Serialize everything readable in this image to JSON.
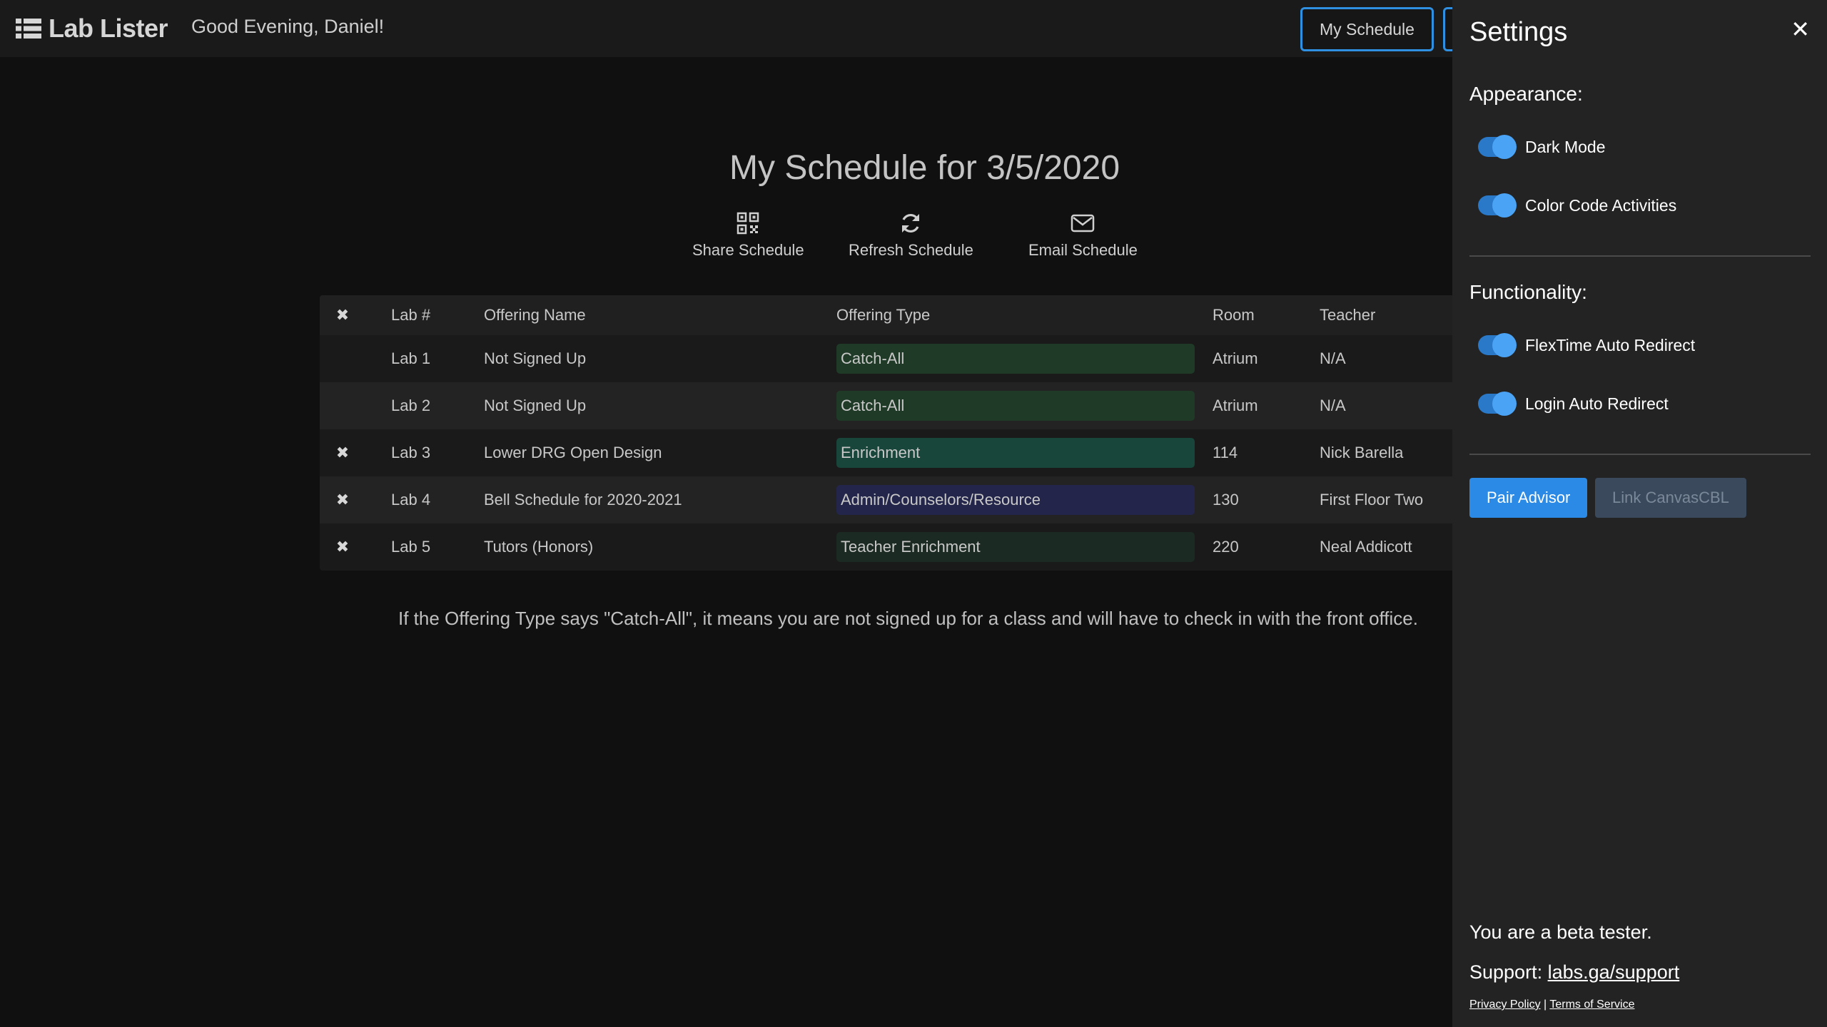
{
  "header": {
    "brand": "Lab Lister",
    "greeting": "Good Evening, Daniel!",
    "nav_button": "My Schedule"
  },
  "main": {
    "title": "My Schedule for 3/5/2020",
    "actions": [
      {
        "label": "Share Schedule",
        "icon": "qr-code-icon"
      },
      {
        "label": "Refresh Schedule",
        "icon": "refresh-icon"
      },
      {
        "label": "Email Schedule",
        "icon": "envelope-icon"
      }
    ],
    "table": {
      "headers": {
        "remove": "✖",
        "lab": "Lab #",
        "name": "Offering Name",
        "type": "Offering Type",
        "room": "Room",
        "teacher": "Teacher"
      },
      "rows": [
        {
          "remove": "",
          "lab": "Lab 1",
          "name": "Not Signed Up",
          "type": "Catch-All",
          "type_color": "#1f3a26",
          "room": "Atrium",
          "teacher": "N/A"
        },
        {
          "remove": "",
          "lab": "Lab 2",
          "name": "Not Signed Up",
          "type": "Catch-All",
          "type_color": "#1f3a26",
          "room": "Atrium",
          "teacher": "N/A"
        },
        {
          "remove": "✖",
          "lab": "Lab 3",
          "name": "Lower DRG Open Design",
          "type": "Enrichment",
          "type_color": "#19463a",
          "room": "114",
          "teacher": "Nick Barella"
        },
        {
          "remove": "✖",
          "lab": "Lab 4",
          "name": "Bell Schedule for 2020-2021",
          "type": "Admin/Counselors/Resource",
          "type_color": "#23264a",
          "room": "130",
          "teacher": "First Floor Two"
        },
        {
          "remove": "✖",
          "lab": "Lab 5",
          "name": "Tutors (Honors)",
          "type": "Teacher Enrichment",
          "type_color": "#1b2a22",
          "room": "220",
          "teacher": "Neal Addicott"
        }
      ]
    },
    "note": "If the Offering Type says \"Catch-All\", it means you are not signed up for a class and will have to check in with the front office."
  },
  "settings": {
    "title": "Settings",
    "close": "✕",
    "appearance_title": "Appearance:",
    "appearance": [
      {
        "label": "Dark Mode",
        "on": true
      },
      {
        "label": "Color Code Activities",
        "on": true
      }
    ],
    "functionality_title": "Functionality:",
    "functionality": [
      {
        "label": "FlexTime Auto Redirect",
        "on": true
      },
      {
        "label": "Login Auto Redirect",
        "on": true
      }
    ],
    "pair_button": "Pair Advisor",
    "link_button": "Link CanvasCBL",
    "beta": "You are a beta tester.",
    "support_label": "Support:",
    "support_link": "labs.ga/support",
    "privacy": "Privacy Policy",
    "separator": "|",
    "terms": "Terms of Service"
  },
  "colors": {
    "accent": "#2a8ae6",
    "background": "#101010",
    "panel": "#232323"
  }
}
